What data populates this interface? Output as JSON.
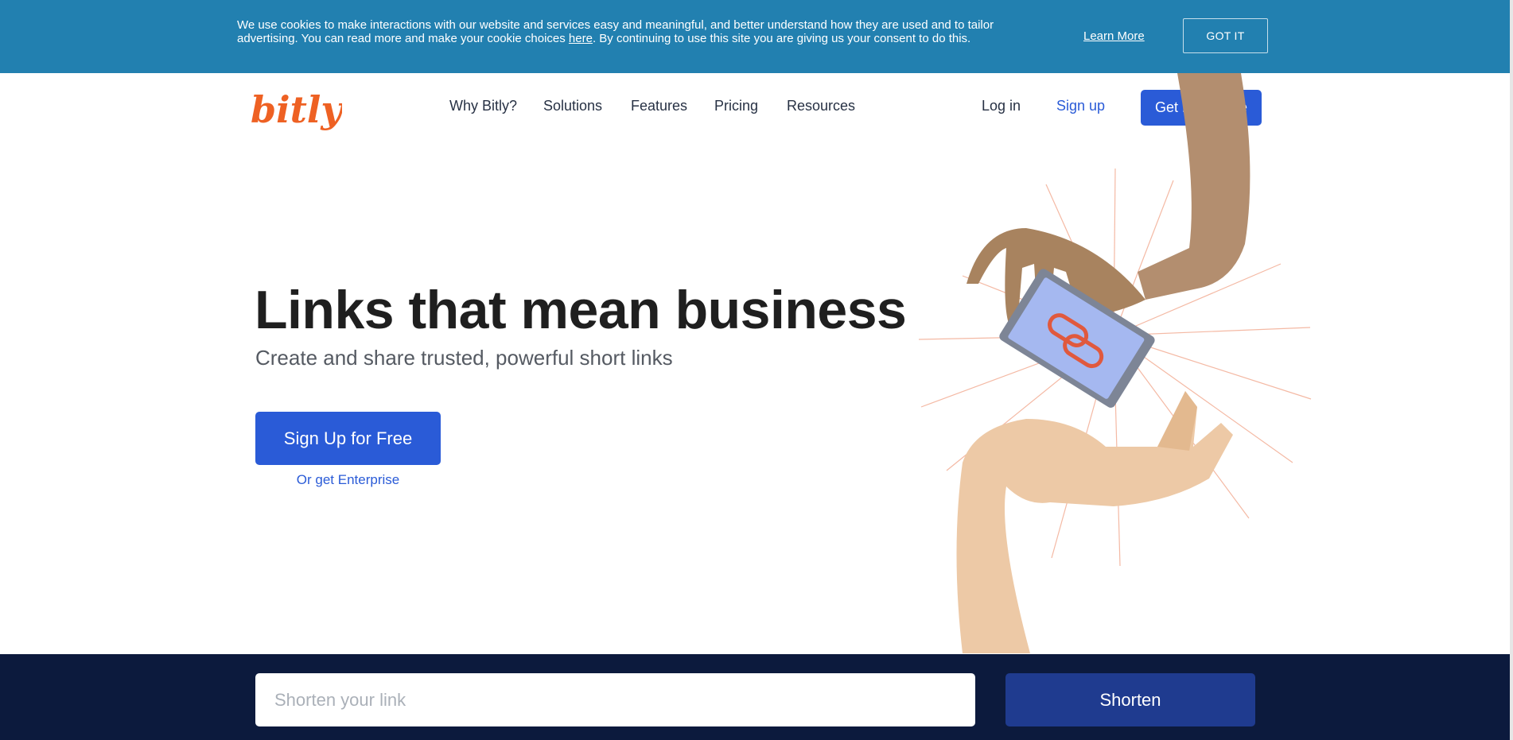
{
  "cookie_banner": {
    "text_before": "We use cookies to make interactions with our website and services easy and meaningful, and better understand how they are used and to tailor advertising. You can read more and make your cookie choices ",
    "link_here": "here",
    "text_after": ". By continuing to use this site you are giving us your consent to do this.",
    "learn_more": "Learn More",
    "got_it": "GOT IT"
  },
  "header": {
    "logo_text": "bitly",
    "nav": [
      "Why Bitly?",
      "Solutions",
      "Features",
      "Pricing",
      "Resources"
    ],
    "login": "Log in",
    "signup": "Sign up",
    "get_enterprise": "Get Enterprise"
  },
  "hero": {
    "title": "Links that mean business",
    "subtitle": "Create and share trusted, powerful short links",
    "cta": "Sign Up for Free",
    "cta_alt": "Or get Enterprise"
  },
  "shorten": {
    "placeholder": "Shorten your link",
    "button": "Shorten"
  },
  "colors": {
    "cookie_bg": "#2280b0",
    "brand_orange": "#ee6123",
    "primary_blue": "#2a5bd7",
    "footer_navy": "#0c1a3d",
    "shorten_button": "#1f3b8f"
  },
  "icons": {
    "illustration": "hands-passing-phone-with-link-icon"
  }
}
